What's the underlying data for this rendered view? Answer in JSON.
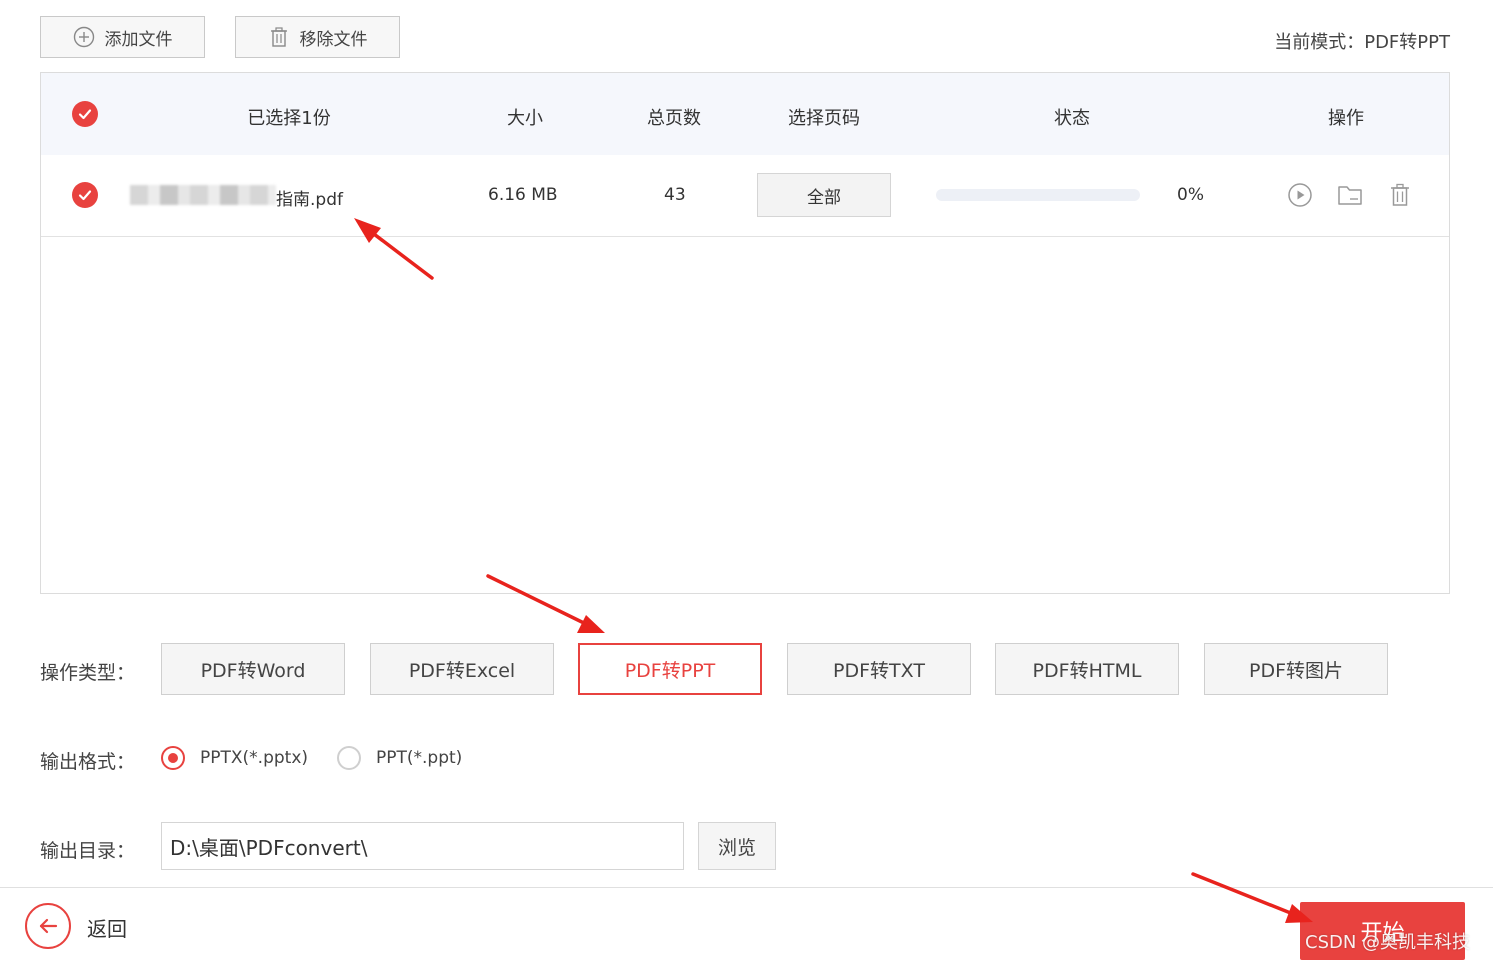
{
  "toolbar": {
    "add_label": "添加文件",
    "add_icon": "plus-circle-icon",
    "remove_label": "移除文件",
    "remove_icon": "trash-icon",
    "mode_text": "当前模式：PDF转PPT"
  },
  "table": {
    "headers": {
      "selected": "已选择1份",
      "size": "大小",
      "pages": "总页数",
      "page_select": "选择页码",
      "status": "状态",
      "actions": "操作"
    },
    "rows": [
      {
        "name_suffix": "指南.pdf",
        "size": "6.16 MB",
        "pages": "43",
        "page_select": "全部",
        "progress_percent": 0,
        "progress_text": "0%"
      }
    ]
  },
  "operation": {
    "label": "操作类型：",
    "types": [
      "PDF转Word",
      "PDF转Excel",
      "PDF转PPT",
      "PDF转TXT",
      "PDF转HTML",
      "PDF转图片"
    ],
    "active": "PDF转PPT"
  },
  "output_format": {
    "label": "输出格式：",
    "options": [
      "PPTX(*.pptx)",
      "PPT(*.ppt)"
    ],
    "selected": "PPTX(*.pptx)"
  },
  "output_dir": {
    "label": "输出目录：",
    "value": "D:\\桌面\\PDFconvert\\",
    "browse_label": "浏览"
  },
  "footer": {
    "back_label": "返回",
    "start_label": "开始",
    "watermark": "CSDN @奥凯丰科技"
  },
  "colors": {
    "accent": "#e8423f",
    "header_bg": "#f5f7fc",
    "border": "#dcdcdc"
  }
}
